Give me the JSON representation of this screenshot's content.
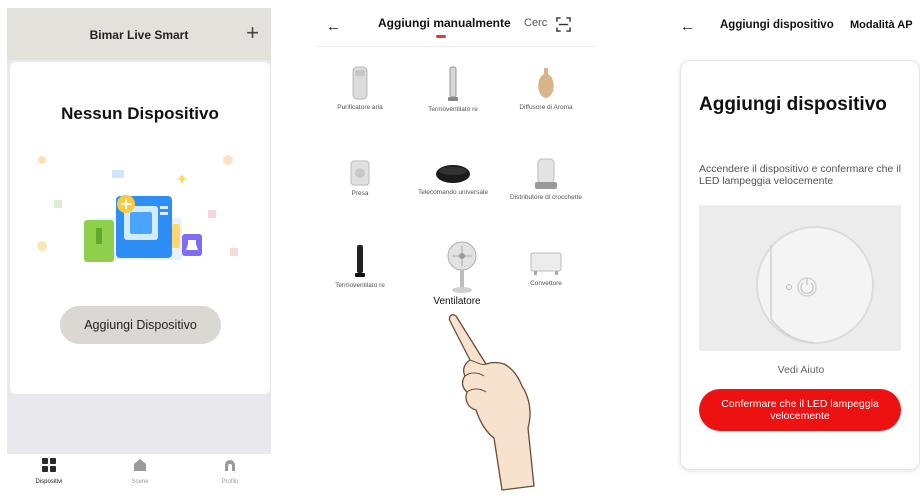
{
  "panel1": {
    "header_title": "Bimar Live Smart",
    "add_icon": "plus-icon",
    "empty_title": "Nessun Dispositivo",
    "add_button": "Aggiungi Dispositivo",
    "tabs": [
      {
        "label": "Dispositivi",
        "icon": "grid-icon",
        "active": true
      },
      {
        "label": "Scene",
        "icon": "home-icon",
        "active": false
      },
      {
        "label": "Profilo",
        "icon": "profile-icon",
        "active": false
      }
    ]
  },
  "panel2": {
    "tab_active": "Aggiungi manualmente",
    "tab_other": "Cerc",
    "scan_icon": "scan-icon",
    "devices": [
      {
        "label": "Purificatore aria",
        "icon": "air-purifier-icon"
      },
      {
        "label": "Termoventilato re",
        "icon": "tower-heater-icon"
      },
      {
        "label": "Diffusore di Aroma",
        "icon": "aroma-diffuser-icon"
      },
      {
        "label": "Presa",
        "icon": "smart-plug-icon"
      },
      {
        "label": "Telecomando universale",
        "icon": "ir-remote-icon"
      },
      {
        "label": "Distributore di crocchette",
        "icon": "pet-feeder-icon"
      },
      {
        "label": "Termoventilato re",
        "icon": "tower-fan-icon"
      },
      {
        "label": "Ventilatore",
        "icon": "fan-icon"
      },
      {
        "label": "Convettore",
        "icon": "convector-icon"
      }
    ],
    "highlight_label": "Ventilatore"
  },
  "panel3": {
    "title": "Aggiungi dispositivo",
    "mode": "Modalità AP",
    "heading": "Aggiungi dispositivo",
    "description": "Accendere il dispositivo e confermare che il LED lampeggia velocemente",
    "help_link": "Vedi Aiuto",
    "confirm_button": "Confermare che il LED lampeggia velocemente"
  },
  "colors": {
    "accent_red": "#ee1111",
    "underline_red": "#e53935",
    "header_bg": "#e3e1dc",
    "button_bg": "#dbd8d3"
  }
}
